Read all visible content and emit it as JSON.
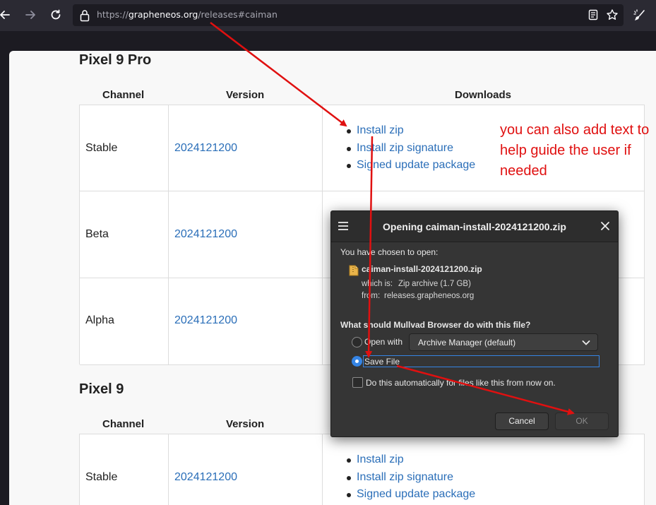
{
  "browser": {
    "url_prefix": "https://",
    "url_host": "grapheneos.org",
    "url_path": "/releases#caiman"
  },
  "sections": [
    {
      "device": "Pixel 9 Pro",
      "headers": [
        "Channel",
        "Version",
        "Downloads"
      ],
      "rows": [
        {
          "channel": "Stable",
          "version": "2024121200",
          "downloads": [
            "Install zip",
            "Install zip signature",
            "Signed update package"
          ]
        },
        {
          "channel": "Beta",
          "version": "2024121200"
        },
        {
          "channel": "Alpha",
          "version": "2024121200"
        }
      ]
    },
    {
      "device": "Pixel 9",
      "headers": [
        "Channel",
        "Version"
      ],
      "rows": [
        {
          "channel": "Stable",
          "version": "2024121200",
          "downloads": [
            "Install zip",
            "Install zip signature",
            "Signed update package"
          ]
        }
      ]
    }
  ],
  "annotation": {
    "note": "you can also add text to help guide the user if needed",
    "color": "#e01010"
  },
  "dialog": {
    "title": "Opening caiman-install-2024121200.zip",
    "chosen_label": "You have chosen to open:",
    "filename": "caiman-install-2024121200.zip",
    "which_is_label": "which is:",
    "which_is_value": "Zip archive (1.7 GB)",
    "from_label": "from:",
    "from_value": "releases.grapheneos.org",
    "question": "What should Mullvad Browser do with this file?",
    "open_with_label": "Open with",
    "open_with_app": "Archive Manager (default)",
    "save_file_label": "Save File",
    "auto_label": "Do this automatically for files like this from now on.",
    "cancel_label": "Cancel",
    "ok_label": "OK",
    "selected_option": "save_file",
    "accent_color": "#3584e4"
  }
}
